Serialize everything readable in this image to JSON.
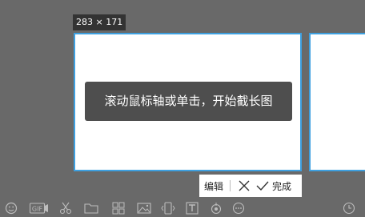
{
  "dimension_label": "283 × 171",
  "scroll_tip": "滚动鼠标轴或单击，开始截长图",
  "action_bar": {
    "edit_label": "编辑",
    "done_label": "完成"
  },
  "toolbar": {
    "gif_label": "GIF",
    "icons": [
      "emoji-icon",
      "gif-record-icon",
      "scissors-icon",
      "folder-icon",
      "layout-icon",
      "image-icon",
      "scroll-capture-icon",
      "text-extract-icon",
      "translate-icon",
      "more-icon",
      "clock-icon"
    ]
  },
  "colors": {
    "background": "#696969",
    "border": "#3ea0e0",
    "tip_bg": "#4e4e4e"
  }
}
